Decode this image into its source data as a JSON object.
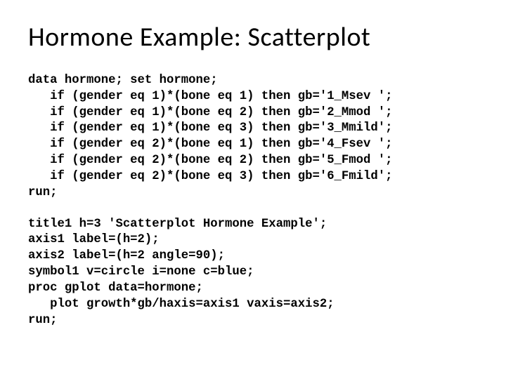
{
  "title": "Hormone Example: Scatterplot",
  "code1": "data hormone; set hormone;\n   if (gender eq 1)*(bone eq 1) then gb='1_Msev ';\n   if (gender eq 1)*(bone eq 2) then gb='2_Mmod ';\n   if (gender eq 1)*(bone eq 3) then gb='3_Mmild';\n   if (gender eq 2)*(bone eq 1) then gb='4_Fsev ';\n   if (gender eq 2)*(bone eq 2) then gb='5_Fmod ';\n   if (gender eq 2)*(bone eq 3) then gb='6_Fmild';\nrun;",
  "code2": "title1 h=3 'Scatterplot Hormone Example';\naxis1 label=(h=2);\naxis2 label=(h=2 angle=90);\nsymbol1 v=circle i=none c=blue;\nproc gplot data=hormone;\n   plot growth*gb/haxis=axis1 vaxis=axis2;\nrun;"
}
